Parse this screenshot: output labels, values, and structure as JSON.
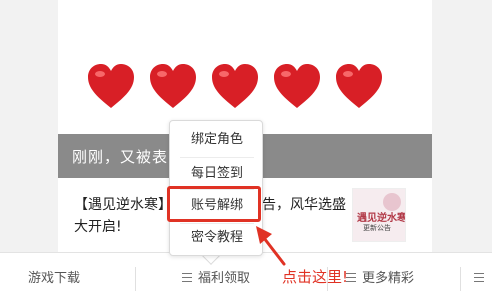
{
  "banner": {
    "text": "刚刚，又被表白"
  },
  "article": {
    "line1_left": "【遇见逆水寒】",
    "line1_right": "公告，风华选盛",
    "line2": "大开启!"
  },
  "thumbnail": {
    "title": "遇见逆水寒",
    "subtitle": "更新公告"
  },
  "popup_menu": {
    "items": [
      {
        "label": "绑定角色"
      },
      {
        "label": "每日签到"
      },
      {
        "label": "账号解绑"
      },
      {
        "label": "密令教程"
      }
    ],
    "highlighted_item": "账号解绑"
  },
  "bottom_nav": {
    "tabs": [
      {
        "label": "游戏下载"
      },
      {
        "label": "福利领取"
      },
      {
        "label": "更多精彩"
      }
    ]
  },
  "annotation": {
    "text": "点击这里!",
    "color": "#e03224"
  },
  "colors": {
    "heart": "#d81f26",
    "banner_bg": "#8a8a8a",
    "annotation_red": "#e03224"
  },
  "icons": [
    "heart-icon",
    "menu-lines-icon",
    "arrow-icon"
  ]
}
